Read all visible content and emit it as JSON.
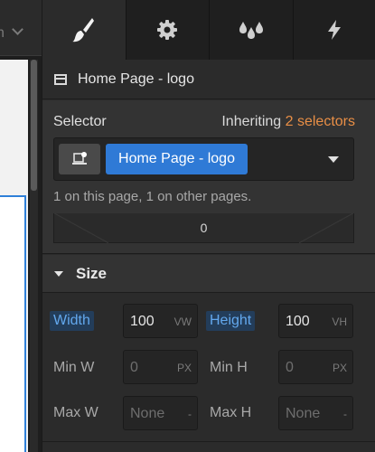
{
  "canvas": {
    "breadcrumb_fragment": "n"
  },
  "tabs": [
    {
      "name": "style",
      "icon": "brush-icon",
      "active": true
    },
    {
      "name": "settings",
      "icon": "gear-icon",
      "active": false
    },
    {
      "name": "interactions",
      "icon": "drops-icon",
      "active": false
    },
    {
      "name": "lightning",
      "icon": "lightning-icon",
      "active": false
    }
  ],
  "element": {
    "name": "Home Page - logo"
  },
  "selector": {
    "label": "Selector",
    "inheriting_prefix": "Inheriting",
    "inheriting_link": "2 selectors",
    "chip": "Home Page - logo",
    "note": "1 on this page, 1 on other pages.",
    "partial_value": "0"
  },
  "size": {
    "title": "Size",
    "width": {
      "label": "Width",
      "value": "100",
      "unit": "VW"
    },
    "height": {
      "label": "Height",
      "value": "100",
      "unit": "VH"
    },
    "min_w": {
      "label": "Min W",
      "value": "0",
      "unit": "PX"
    },
    "min_h": {
      "label": "Min H",
      "value": "0",
      "unit": "PX"
    },
    "max_w": {
      "label": "Max W",
      "value": "None",
      "unit": "-"
    },
    "max_h": {
      "label": "Max H",
      "value": "None",
      "unit": "-"
    }
  },
  "colors": {
    "accent": "#2f7ad6",
    "link": "#e98f46",
    "active_label": "#63a8ee"
  }
}
